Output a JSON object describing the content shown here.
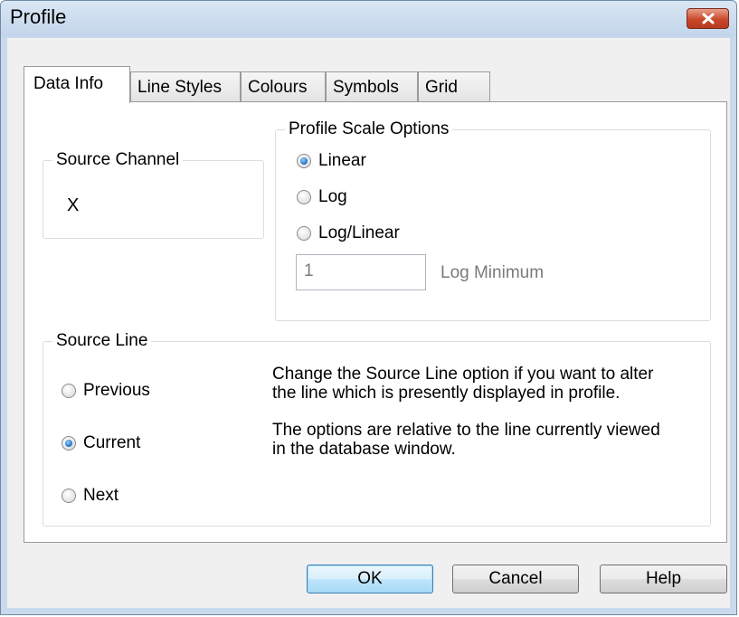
{
  "window": {
    "title": "Profile",
    "close_icon": "close-icon"
  },
  "tabs": [
    {
      "label": "Data Info",
      "active": true
    },
    {
      "label": "Line Styles",
      "active": false
    },
    {
      "label": "Colours",
      "active": false
    },
    {
      "label": "Symbols",
      "active": false
    },
    {
      "label": "Grid",
      "active": false
    }
  ],
  "source_channel": {
    "legend": "Source Channel",
    "value": "X"
  },
  "scale_options": {
    "legend": "Profile Scale Options",
    "options": [
      {
        "label": "Linear",
        "checked": true
      },
      {
        "label": "Log",
        "checked": false
      },
      {
        "label": "Log/Linear",
        "checked": false
      }
    ],
    "log_minimum_value": "1",
    "log_minimum_label": "Log Minimum"
  },
  "source_line": {
    "legend": "Source Line",
    "options": [
      {
        "label": "Previous",
        "checked": false
      },
      {
        "label": "Current",
        "checked": true
      },
      {
        "label": "Next",
        "checked": false
      }
    ],
    "help_paragraph_1": "Change the Source Line option if you want to alter the line which is presently displayed in profile.",
    "help_paragraph_2": "The options are relative to the line currently viewed in the database window."
  },
  "buttons": {
    "ok": "OK",
    "cancel": "Cancel",
    "help": "Help"
  },
  "colors": {
    "titlebar": "#c2d5ea",
    "close_button": "#c9482c",
    "dialog_background": "#f0f0f0",
    "default_button_border": "#3c7fb1"
  }
}
